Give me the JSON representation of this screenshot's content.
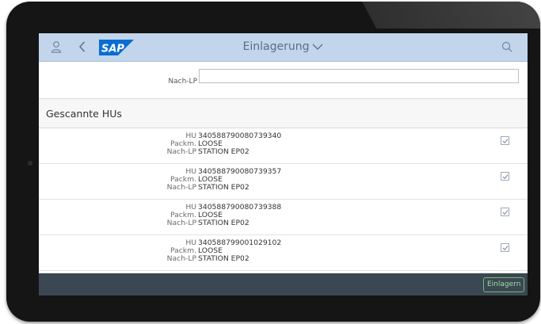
{
  "shell": {
    "title": "Einlagerung",
    "colors": {
      "shellbar": "#c2d5ea",
      "footer": "#3b4753",
      "sap_blue": "#0a6ed1",
      "accept": "#6ebd6e"
    }
  },
  "form": {
    "nach_lp_label": "Nach-LP",
    "nach_lp_value": ""
  },
  "section": {
    "title": "Gescannte HUs"
  },
  "list": {
    "labels": {
      "hu": "HU",
      "packm": "Packm.",
      "nach_lp": "Nach-LP"
    },
    "items": [
      {
        "hu": "340588790080739340",
        "packm": "LOOSE",
        "nach_lp": "STATION EP02",
        "checked": true
      },
      {
        "hu": "340588790080739357",
        "packm": "LOOSE",
        "nach_lp": "STATION EP02",
        "checked": true
      },
      {
        "hu": "340588790080739388",
        "packm": "LOOSE",
        "nach_lp": "STATION EP02",
        "checked": true
      },
      {
        "hu": "340588799001029102",
        "packm": "LOOSE",
        "nach_lp": "STATION EP02",
        "checked": true
      }
    ]
  },
  "footer": {
    "primary_button": "Einlagern"
  }
}
